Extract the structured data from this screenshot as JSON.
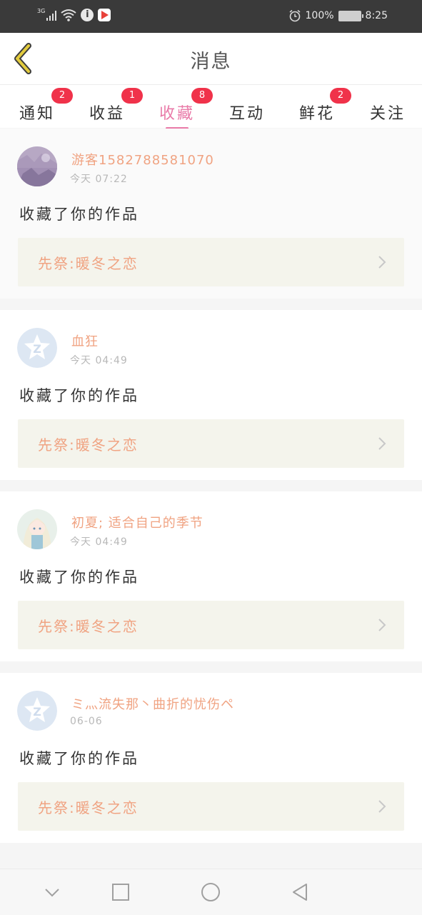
{
  "status_bar": {
    "network": "3G",
    "battery": "100%",
    "time": "8:25"
  },
  "header": {
    "title": "消息",
    "back_icon": "back-chevron-icon"
  },
  "tabs": [
    {
      "label": "通知",
      "badge": "2",
      "active": false
    },
    {
      "label": "收益",
      "badge": "1",
      "active": false
    },
    {
      "label": "收藏",
      "badge": "8",
      "active": true
    },
    {
      "label": "互动",
      "badge": "",
      "active": false
    },
    {
      "label": "鲜花",
      "badge": "2",
      "active": false
    },
    {
      "label": "关注",
      "badge": "",
      "active": false
    }
  ],
  "messages": [
    {
      "user": "游客1582788581070",
      "time": "今天  07:22",
      "action": "收藏了你的作品",
      "work": "先祭:暖冬之恋",
      "avatar": "photo"
    },
    {
      "user": "血狂",
      "time": "今天  04:49",
      "action": "收藏了你的作品",
      "work": "先祭:暖冬之恋",
      "avatar": "default"
    },
    {
      "user": "初夏;  适合自己的季节",
      "time": "今天  04:49",
      "action": "收藏了你的作品",
      "work": "先祭:暖冬之恋",
      "avatar": "anime"
    },
    {
      "user": "ミ灬流失那丶曲折的忧伤ペ",
      "time": "06-06",
      "action": "收藏了你的作品",
      "work": "先祭:暖冬之恋",
      "avatar": "default"
    }
  ],
  "colors": {
    "accent": "#e97aa8",
    "badge": "#f0324a",
    "name": "#f0a382",
    "back_icon": "#d9c23a"
  }
}
